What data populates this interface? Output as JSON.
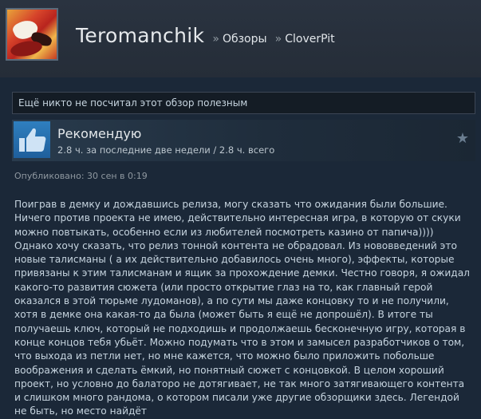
{
  "header": {
    "user_name": "Teromanchik",
    "separator": "»",
    "breadcrumb_reviews": "Обзоры",
    "breadcrumb_game": "CloverPit"
  },
  "helpful_text": "Ещё никто не посчитал этот обзор полезным",
  "recommendation": {
    "title": "Рекомендую",
    "hours": "2.8 ч. за последние две недели / 2.8 ч. всего",
    "thumb_icon": "thumbs-up-icon",
    "star_icon": "star-icon"
  },
  "posted": "Опубликовано: 30 сен в 0:19",
  "review_text": "Поиграв в демку и дождавшись релиза, могу сказать что ожидания были большие. Ничего против проекта не имею, действительно интересная игра, в которую от скуки можно повтыкать, особенно если из любителей посмотреть казино от папича)))) Однако хочу сказать, что релиз тонной контента не обрадовал. Из нововведений это новые талисманы ( а их действительно добавилось очень много), эффекты, которые привязаны к этим талисманам и ящик за прохождение демки. Честно говоря, я ожидал какого-то развития сюжета (или просто открытие глаз на то, как главный герой оказался в этой тюрьме лудоманов), а по сути мы даже концовку то и не получили, хотя в демке она какая-то да была (может быть я ещё не допрошёл). В итоге ты получаешь ключ, который не подходишь и продолжаешь бесконечную игру, которая в конце концов тебя убьёт. Можно подумать что в этом и замысел разработчиков о том, что выхода из петли нет, но мне кажется, что можно было приложить побольше воображения и сделать ёмкий, но понятный сюжет с концовкой. В целом хороший проект, но условно до балаторо не дотягивает, не так много затягивающего контента и слишком много рандома, о котором писали уже другие обзорщики здесь. Легендой не быть, но место найдёт",
  "colors": {
    "background": "#1b2838",
    "header_bg": "#2a3340",
    "thumb_blue": "#2f7fbf",
    "text": "#c6d4df"
  }
}
